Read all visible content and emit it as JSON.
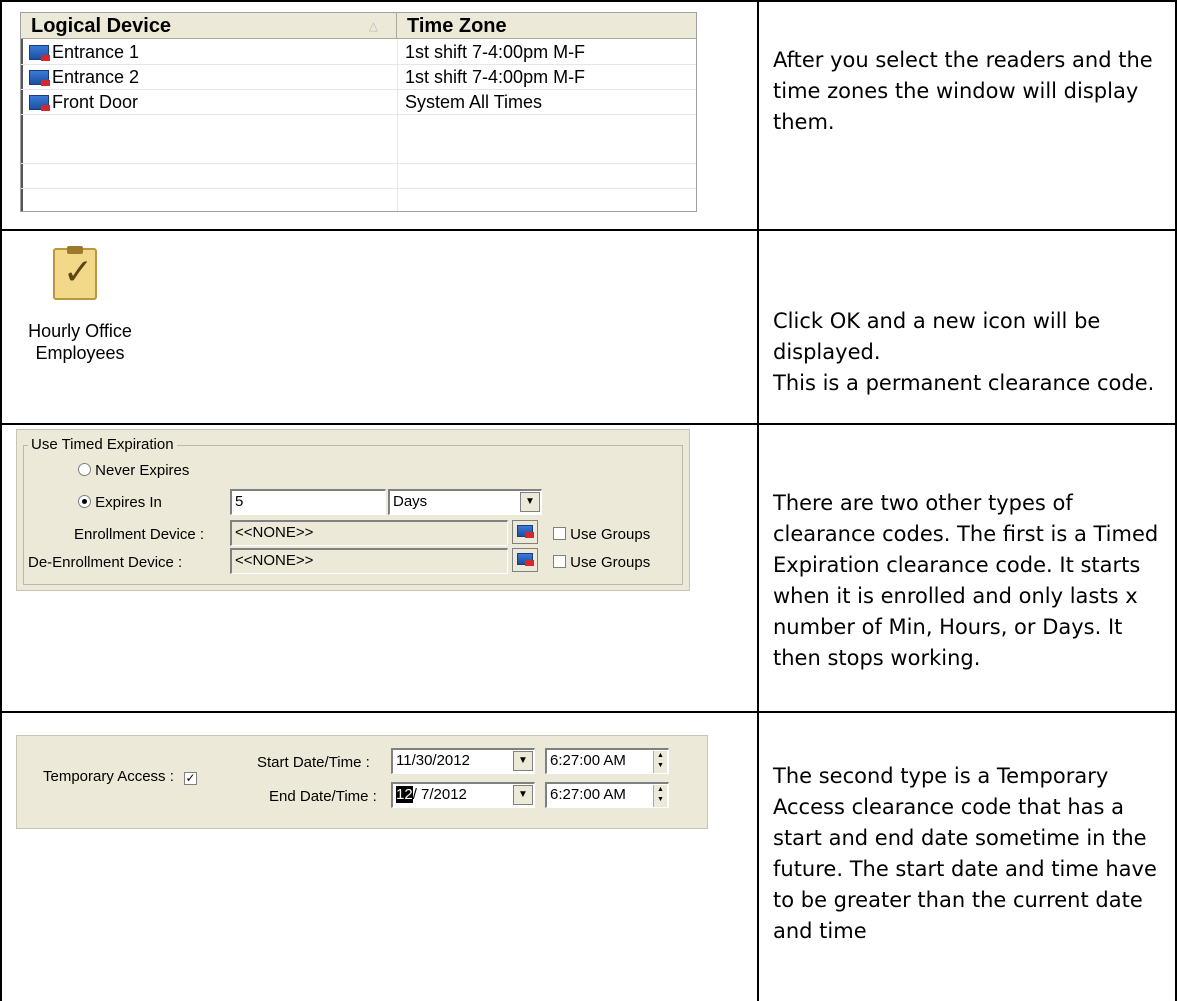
{
  "rows": [
    {
      "text": [
        "After you select the readers and the time zones the window will display them."
      ]
    },
    {
      "text": [
        "Click OK and a new icon will be displayed.",
        "This is a permanent clearance code."
      ]
    },
    {
      "text": [
        "There are two other types of clearance codes. The first is a Timed Expiration clearance code. It starts when it is enrolled and only lasts x number of Min, Hours, or Days. It then stops working."
      ]
    },
    {
      "text": [
        "The second type is a Temporary Access clearance code that has a start and end date sometime in the future. The start date and time have to be  greater than the current date and time"
      ]
    }
  ],
  "listview": {
    "columns": [
      "Logical Device",
      "Time Zone"
    ],
    "rows": [
      {
        "device": "Entrance 1",
        "zone": "1st shift 7-4:00pm M-F"
      },
      {
        "device": "Entrance 2",
        "zone": "1st shift 7-4:00pm M-F"
      },
      {
        "device": "Front Door",
        "zone": "System All Times"
      }
    ]
  },
  "icon": {
    "name": "clipboard-check-icon",
    "label_line1": "Hourly Office",
    "label_line2": "Employees"
  },
  "timed": {
    "group_title": "Use Timed Expiration",
    "never_label": "Never Expires",
    "expires_label": "Expires In",
    "expires_value": "5",
    "unit": "Days",
    "enroll_label": "Enrollment Device :",
    "enroll_value": "<<NONE>>",
    "deenroll_label": "De-Enrollment Device :",
    "deenroll_value": "<<NONE>>",
    "use_groups": "Use Groups"
  },
  "temp": {
    "access_label": "Temporary Access :",
    "start_label": "Start Date/Time :",
    "start_date": "11/30/2012",
    "start_time": "6:27:00 AM",
    "end_label": "End Date/Time :",
    "end_date_sel": "12",
    "end_date_rest": "/ 7/2012",
    "end_time": "6:27:00 AM"
  }
}
